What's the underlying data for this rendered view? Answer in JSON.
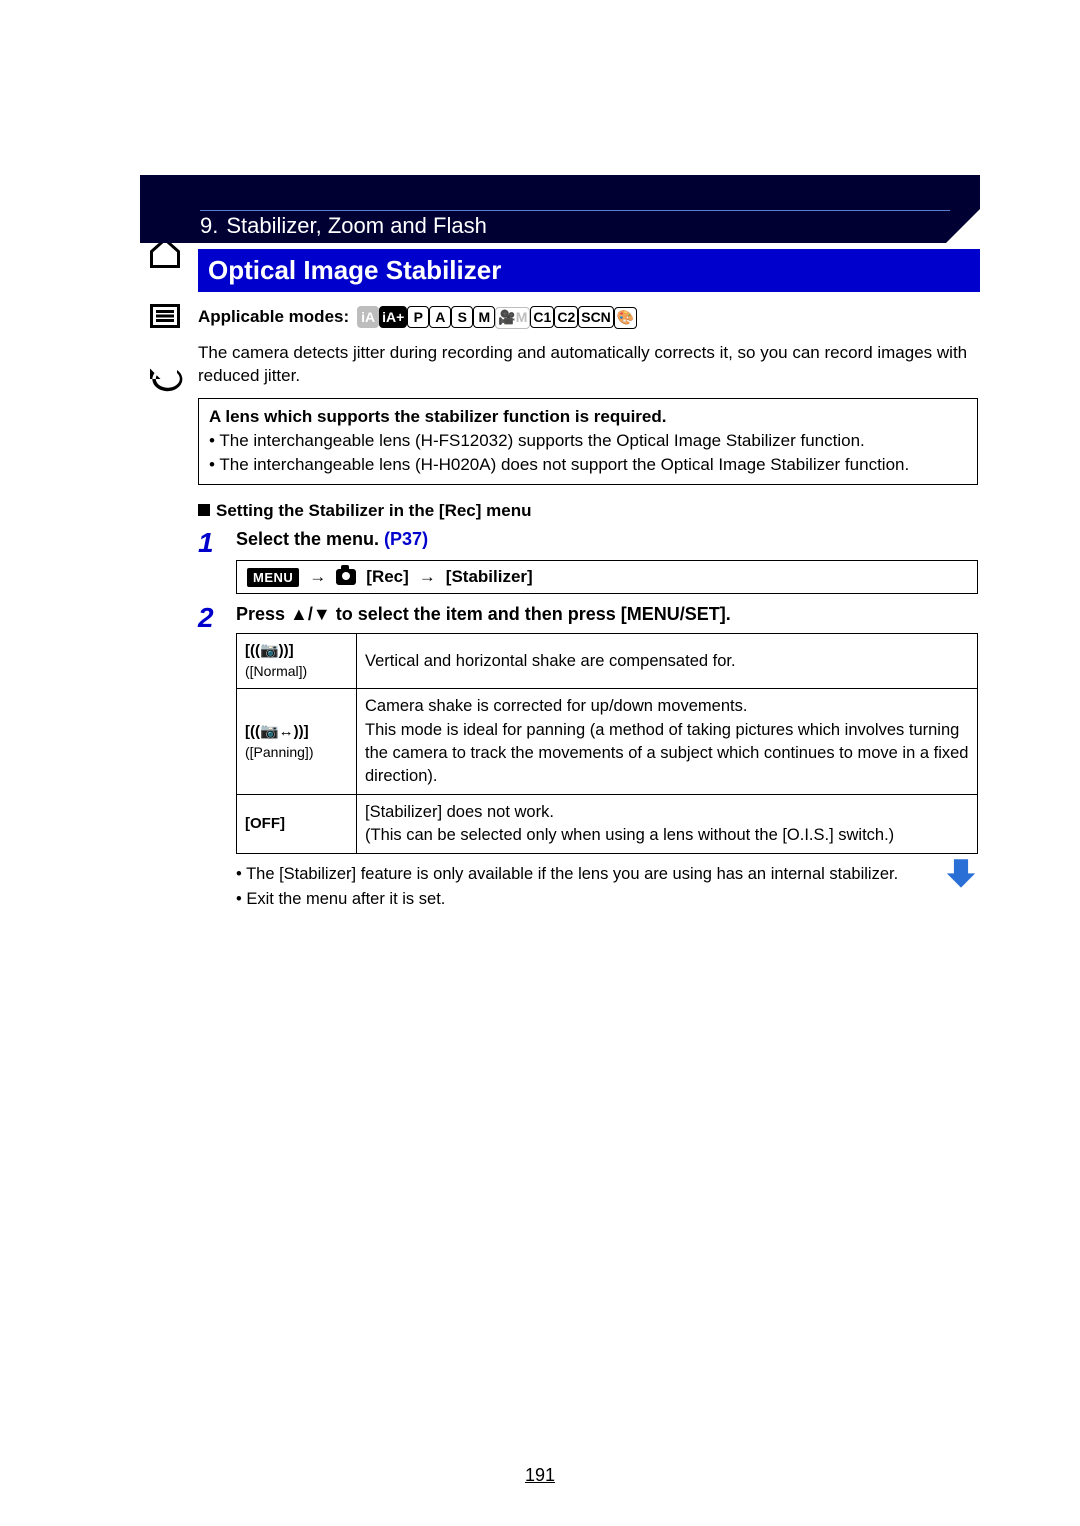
{
  "chapter": {
    "num": "9.",
    "title": "Stabilizer, Zoom and Flash"
  },
  "section_title": "Optical Image Stabilizer",
  "applicable_label": "Applicable modes:",
  "modes": [
    {
      "label": "iA",
      "dim": true,
      "solid": true
    },
    {
      "label": "iA+",
      "dim": false,
      "solid": true
    },
    {
      "label": "P",
      "dim": false,
      "solid": false
    },
    {
      "label": "A",
      "dim": false,
      "solid": false
    },
    {
      "label": "S",
      "dim": false,
      "solid": false
    },
    {
      "label": "M",
      "dim": false,
      "solid": false
    },
    {
      "label": "🎥M",
      "dim": true,
      "solid": false
    },
    {
      "label": "C1",
      "dim": false,
      "solid": false
    },
    {
      "label": "C2",
      "dim": false,
      "solid": false
    },
    {
      "label": "SCN",
      "dim": false,
      "solid": false
    },
    {
      "label": "🎨",
      "dim": false,
      "solid": false
    }
  ],
  "intro": "The camera detects jitter during recording and automatically corrects it, so you can record images with reduced jitter.",
  "lens_note": {
    "header": "A lens which supports the stabilizer function is required.",
    "b1": "• The interchangeable lens (H-FS12032) supports the Optical Image Stabilizer function.",
    "b2": "• The interchangeable lens (H-H020A) does not support the Optical Image Stabilizer function."
  },
  "subheading": "Setting the Stabilizer in the [Rec] menu",
  "steps": {
    "s1": {
      "num": "1",
      "title_a": "Select the menu. ",
      "link": "(P37)"
    },
    "menu_path": {
      "menu": "MENU",
      "rec": "[Rec]",
      "stab": "[Stabilizer]"
    },
    "s2": {
      "num": "2",
      "title": "Press 3/4 to select the item and then press [MENU/SET]."
    }
  },
  "options": {
    "normal": {
      "icon": "[((📷))]",
      "label": "([Normal])",
      "desc": "Vertical and horizontal shake are compensated for."
    },
    "panning": {
      "icon": "[((📷↔))]",
      "label": "([Panning])",
      "desc": "Camera shake is corrected for up/down movements.\nThis mode is ideal for panning (a method of taking pictures which involves turning the camera to track the movements of a subject which continues to move in a fixed direction)."
    },
    "off": {
      "label": "[OFF]",
      "desc": "[Stabilizer] does not work.\n(This can be selected only when using a lens without the [O.I.S.] switch.)"
    }
  },
  "notes": {
    "n1": "• The [Stabilizer] feature is only available if the lens you are using has an internal stabilizer.",
    "n2": "• Exit the menu after it is set."
  },
  "page_number": "191"
}
